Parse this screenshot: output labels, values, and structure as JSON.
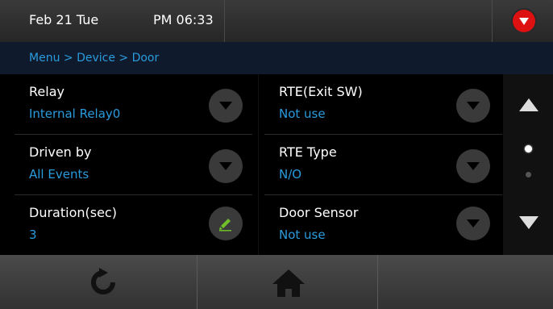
{
  "status": {
    "date": "Feb 21 Tue",
    "time": "PM 06:33",
    "alert_icon": "chevron-down-icon"
  },
  "breadcrumb": "Menu > Device > Door",
  "settings": [
    {
      "label": "Relay",
      "value": "Internal Relay0",
      "control": "dropdown"
    },
    {
      "label": "RTE(Exit SW)",
      "value": "Not use",
      "control": "dropdown"
    },
    {
      "label": "Driven by",
      "value": "All Events",
      "control": "dropdown"
    },
    {
      "label": "RTE Type",
      "value": "N/O",
      "control": "dropdown"
    },
    {
      "label": "Duration(sec)",
      "value": "3",
      "control": "edit"
    },
    {
      "label": "Door Sensor",
      "value": "Not use",
      "control": "dropdown"
    }
  ],
  "pager": {
    "page": 1,
    "pages": 2
  },
  "bottom_bar": {
    "buttons": [
      "refresh-icon",
      "home-icon"
    ]
  },
  "colors": {
    "accent": "#2a9bdc",
    "alert": "#dd1111",
    "edit": "#6fbe2a",
    "background": "#000000"
  }
}
